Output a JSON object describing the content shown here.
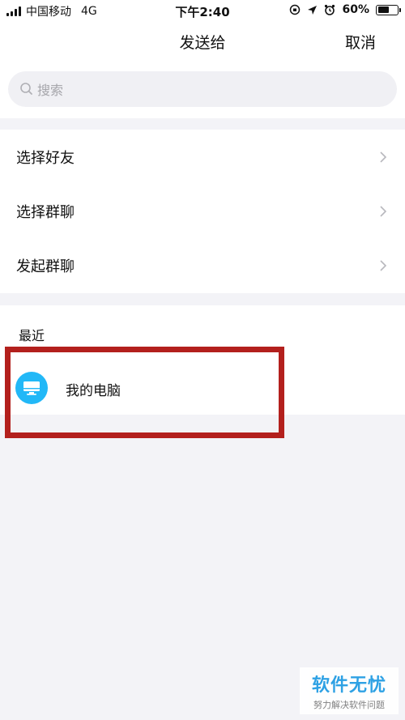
{
  "status_bar": {
    "carrier": "中国移动",
    "network": "4G",
    "time": "下午2:40",
    "battery": "60%",
    "battery_level": 0.6
  },
  "nav": {
    "title": "发送给",
    "cancel_label": "取消"
  },
  "search": {
    "placeholder": "搜索"
  },
  "menu": {
    "items": [
      {
        "label": "选择好友"
      },
      {
        "label": "选择群聊"
      },
      {
        "label": "发起群聊"
      }
    ]
  },
  "recent": {
    "header": "最近",
    "items": [
      {
        "name": "我的电脑",
        "icon": "monitor-icon"
      }
    ]
  },
  "watermark": {
    "title": "软件无忧",
    "subtitle": "努力解决软件问题"
  },
  "colors": {
    "accent": "#22b8f7",
    "highlight": "#b3201d",
    "background": "#f3f3f7"
  }
}
